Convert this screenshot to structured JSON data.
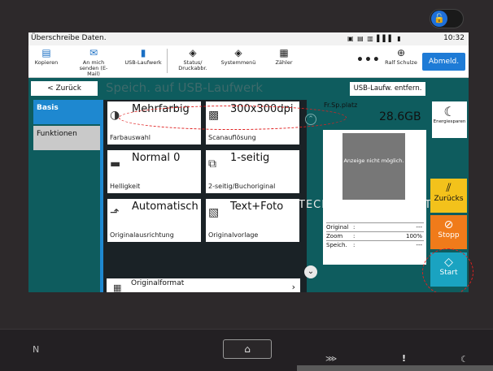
{
  "status": {
    "message": "Überschreibe Daten.",
    "time": "10:32",
    "indicators": "▣ ▤ ▥ ▌▌▌ ▮"
  },
  "toolbar": {
    "items": [
      {
        "label": "Kopieren",
        "icon": "copy-icon",
        "glyph": "▤"
      },
      {
        "label": "An mich senden (E-Mail)",
        "icon": "mail-icon",
        "glyph": "✉"
      },
      {
        "label": "USB-Laufwerk",
        "icon": "usb-icon",
        "glyph": "▮"
      },
      {
        "label": "Status/ Druckabbr.",
        "icon": "status-icon",
        "glyph": "◈"
      },
      {
        "label": "Systemmenü",
        "icon": "system-menu-icon",
        "glyph": "◈"
      },
      {
        "label": "Zähler",
        "icon": "counter-icon",
        "glyph": "▦"
      }
    ],
    "more": "•••",
    "user_glyph": "⊕",
    "user_name": "Ralf Schulze",
    "logout_label": "Abmeld."
  },
  "header": {
    "back_label": "< Zurück",
    "title": "Speich. auf USB-Laufwerk",
    "remove_label": "USB-Laufw. entfern."
  },
  "tabs": {
    "basis": "Basis",
    "funktionen": "Funktionen"
  },
  "cards": [
    {
      "value": "Mehrfarbig",
      "label": "Farbauswahl",
      "icon": "color-icon",
      "glyph": "◑"
    },
    {
      "value": "300x300dpi",
      "label": "Scanauflösung",
      "icon": "resolution-icon",
      "glyph": "▩"
    },
    {
      "value": "Normal 0",
      "label": "Helligkeit",
      "icon": "brightness-icon",
      "glyph": "▬"
    },
    {
      "value": "1-seitig",
      "label": "2-seitig/Buchoriginal",
      "icon": "duplex-icon",
      "glyph": "⧉"
    },
    {
      "value": "Automatisch",
      "label": "Originalausrichtung",
      "icon": "orientation-icon",
      "glyph": "⬏"
    },
    {
      "value": "Text+Foto",
      "label": "Originalvorlage",
      "icon": "original-type-icon",
      "glyph": "▧"
    }
  ],
  "originalformat": {
    "label": "Originalformat",
    "glyph": "▦",
    "chevron": "›"
  },
  "scroll": {
    "up": "⌃",
    "down": "⌄"
  },
  "background_text": {
    "left": "TECH",
    "right": "T"
  },
  "storage": {
    "label": "Fr.Sp.platz",
    "value": "28.6GB"
  },
  "preview": {
    "placeholder": "Anzeige nicht möglich.",
    "rows": [
      {
        "key": "Original",
        "value": "---"
      },
      {
        "key": "Zoom",
        "value": "100%"
      },
      {
        "key": "Speich.",
        "value": "---"
      }
    ],
    "separator": ":"
  },
  "energy": {
    "label": "Energiesparen",
    "glyph": "☾"
  },
  "zuruecks": {
    "label": "Zurücks",
    "glyph": "⫽"
  },
  "stopp": {
    "label": "Stopp",
    "glyph": "⊘"
  },
  "start": {
    "label": "Start",
    "glyph": "◇"
  },
  "lock": {
    "glyph": "🔓"
  },
  "bezel": {
    "nfc": "N",
    "home": "⌂",
    "ind1": "⋙",
    "ind2": "!",
    "ind3": "☾"
  }
}
